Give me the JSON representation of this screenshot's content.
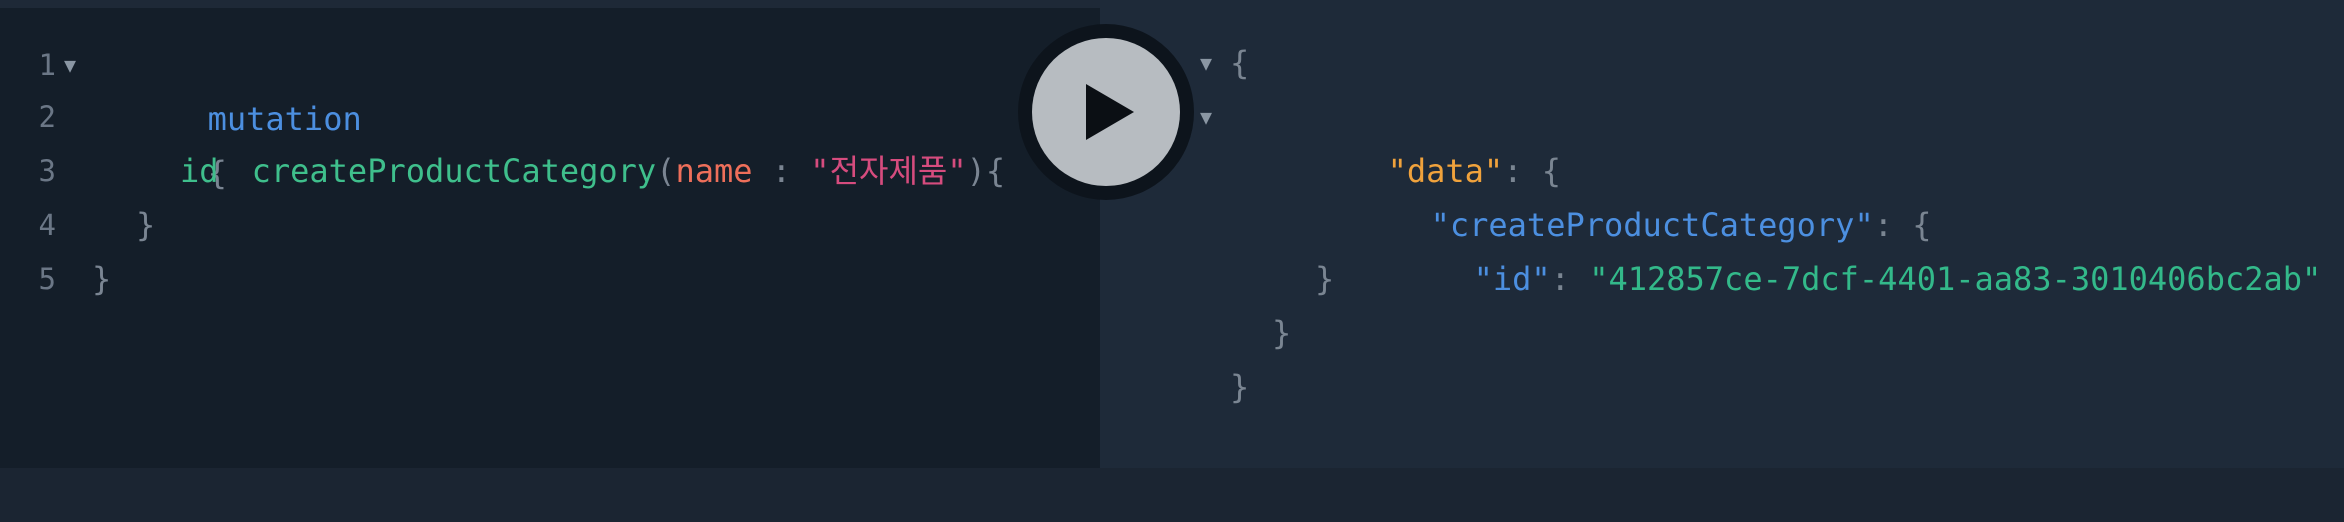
{
  "editor": {
    "lines": [
      {
        "num": "1",
        "fold": "▼",
        "keyword": "mutation",
        "brace": "{"
      },
      {
        "num": "2",
        "field": "createProductCategory",
        "open_paren": "(",
        "arg_name": "name",
        "colon": " : ",
        "arg_value": "\"전자제품\"",
        "close": "){"
      },
      {
        "num": "3",
        "field": "id"
      },
      {
        "num": "4",
        "brace": "}"
      },
      {
        "num": "5",
        "brace": "}"
      }
    ]
  },
  "run_button": {
    "icon": "play-icon"
  },
  "results": {
    "fold_markers": [
      "▼",
      "▼"
    ],
    "open_brace": "{",
    "data_key": "\"data\"",
    "colon": ": ",
    "data_open": "{",
    "mutation_key": "\"createProductCategory\"",
    "mutation_open": "{",
    "id_key": "\"id\"",
    "id_value": "\"412857ce-7dcf-4401-aa83-3010406bc2ab\"",
    "close_1": "}",
    "close_2": "}",
    "close_3": "}"
  },
  "colors": {
    "editor_bg": "#141e29",
    "results_bg": "#1e2a39",
    "keyword": "#4c8fe0",
    "field": "#3fbf8c",
    "argument": "#ee6f5a",
    "string": "#d64c7e",
    "json_key_data": "#f0a23c",
    "json_string": "#33b98a"
  }
}
